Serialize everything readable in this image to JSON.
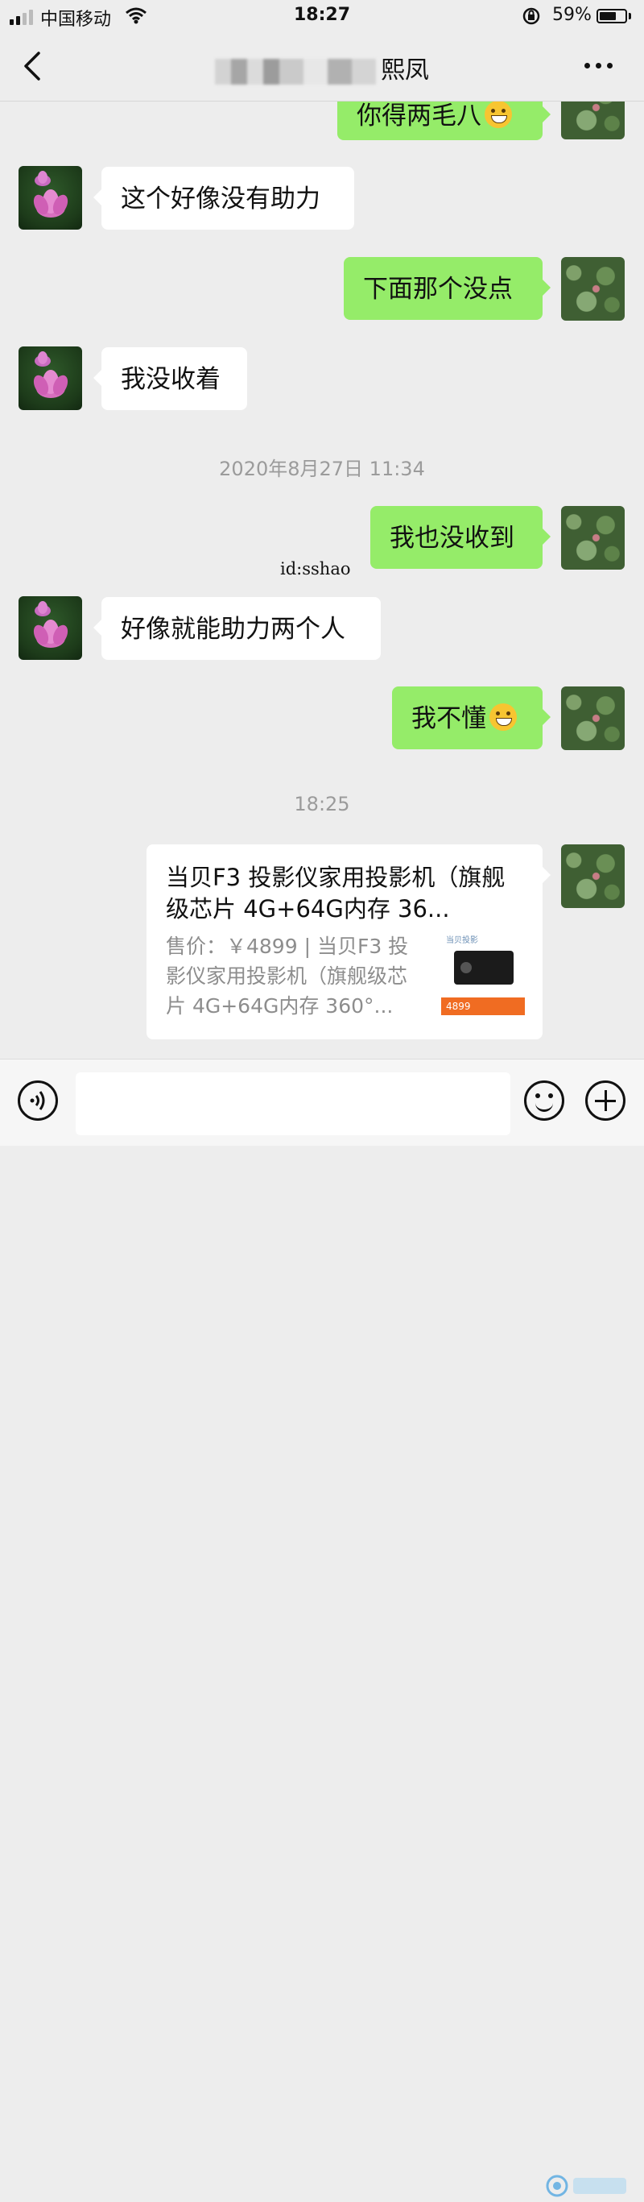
{
  "status_bar": {
    "carrier": "中国移动",
    "time": "18:27",
    "battery_percent": "59%",
    "battery_level": 0.59,
    "icons": [
      "signal-icon",
      "wifi-icon",
      "orientation-lock-icon",
      "battery-icon"
    ]
  },
  "nav": {
    "title": "熙凤",
    "back_icon": "chevron-left-icon",
    "more_icon": "more-icon"
  },
  "messages": [
    {
      "side": "out",
      "text": "你得两毛八",
      "emoji": "grinning-emoji"
    },
    {
      "side": "in",
      "text": "这个好像没有助力"
    },
    {
      "side": "out",
      "text": "下面那个没点"
    },
    {
      "side": "in",
      "text": "我没收着"
    },
    {
      "side": "out",
      "text": "我也没收到"
    },
    {
      "side": "in",
      "text": "好像就能助力两个人"
    },
    {
      "side": "out",
      "text": "我不懂",
      "emoji": "thinking-emoji"
    }
  ],
  "timestamps": [
    "2020年8月27日 11:34",
    "18:25"
  ],
  "watermark": "id:sshao",
  "product_card": {
    "title": "当贝F3 投影仪家用投影机（旗舰级芯片 4G+64G内存 36...",
    "description": "售价：￥4899 | 当贝F3 投影仪家用投影机（旗舰级芯片 4G+64G内存 360°...",
    "thumb_brand": "当贝投影",
    "thumb_price": "4899"
  },
  "input_bar": {
    "voice_icon": "voice-icon",
    "emoji_icon": "emoji-icon",
    "plus_icon": "plus-icon"
  },
  "colors": {
    "background": "#ededed",
    "bubble_out": "#95ec69",
    "bubble_in": "#ffffff",
    "timestamp": "#9b9b9b"
  }
}
